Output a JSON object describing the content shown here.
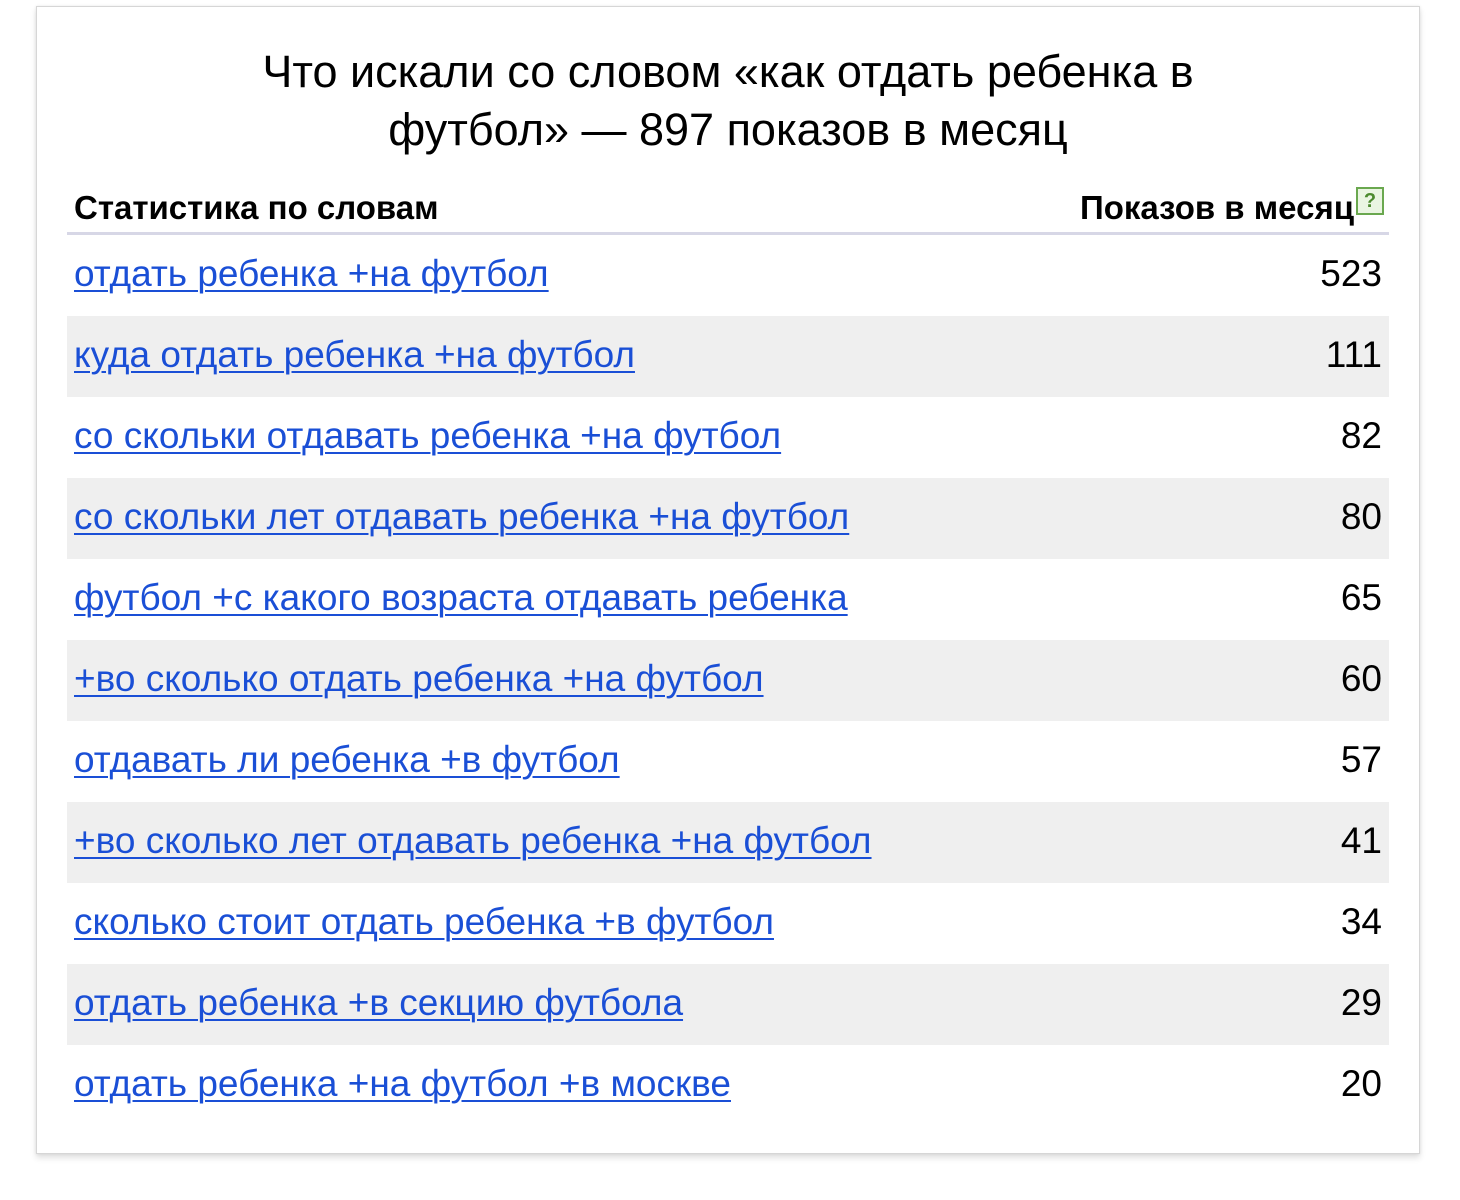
{
  "title": {
    "line1": "Что искали со словом «как отдать ребенка в",
    "line2": "футбол» — 897 показов в месяц"
  },
  "table": {
    "col_words": "Статистика по словам",
    "col_impressions": "Показов в месяц",
    "help_icon_glyph": "?",
    "rows": [
      {
        "phrase": "отдать ребенка +на футбол",
        "count": "523"
      },
      {
        "phrase": "куда отдать ребенка +на футбол",
        "count": "111"
      },
      {
        "phrase": "со скольки отдавать ребенка +на футбол",
        "count": "82"
      },
      {
        "phrase": "со скольки лет отдавать ребенка +на футбол",
        "count": "80"
      },
      {
        "phrase": "футбол +с какого возраста отдавать ребенка",
        "count": "65"
      },
      {
        "phrase": "+во сколько отдать ребенка +на футбол",
        "count": "60"
      },
      {
        "phrase": "отдавать ли ребенка +в футбол",
        "count": "57"
      },
      {
        "phrase": "+во сколько лет отдавать ребенка +на футбол",
        "count": "41"
      },
      {
        "phrase": "сколько стоит отдать ребенка +в футбол",
        "count": "34"
      },
      {
        "phrase": "отдать ребенка +в секцию футбола",
        "count": "29"
      },
      {
        "phrase": "отдать ребенка +на футбол +в москве",
        "count": "20"
      }
    ]
  },
  "colors": {
    "link": "#1a4fd6",
    "row_shade": "#efefef",
    "header_rule": "#d7d7e6",
    "help_icon": "#6aa84f"
  }
}
